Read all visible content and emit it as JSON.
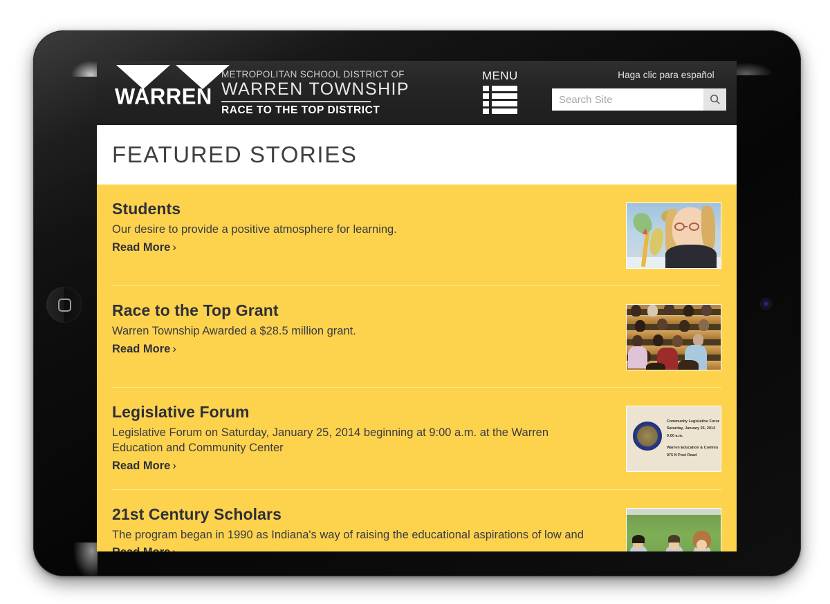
{
  "device": {
    "type": "tablet",
    "home_button": "home-button",
    "camera": "front-camera"
  },
  "header": {
    "logo_word": "WARREN",
    "line1": "METROPOLITAN SCHOOL DISTRICT OF",
    "line2": "WARREN TOWNSHIP",
    "line3": "RACE TO THE TOP DISTRICT",
    "menu_label": "MENU",
    "espanol_label": "Haga clic para español",
    "search_placeholder": "Search Site",
    "search_value": "",
    "bg_color": "#252525"
  },
  "page": {
    "title": "FEATURED STORIES",
    "accent_color": "#fdd34e",
    "title_color": "#3f3f3f"
  },
  "stories": [
    {
      "title": "Students",
      "desc": "Our desire to provide a positive atmosphere for learning.",
      "read_more": "Read More",
      "chevron": "›",
      "thumb_name": "thumbnail-student-with-map"
    },
    {
      "title": "Race to the Top Grant",
      "desc": "Warren Township Awarded a $28.5 million grant.",
      "read_more": "Read More",
      "chevron": "›",
      "thumb_name": "thumbnail-lecture-hall"
    },
    {
      "title": "Legislative Forum",
      "desc": "Legislative Forum on Saturday, January 25, 2014 beginning at 9:00 a.m. at the Warren Education and Community Center",
      "read_more": "Read More",
      "chevron": "›",
      "thumb_name": "thumbnail-legislative-forum-flyer",
      "flyer": {
        "line1": "Community Legislative Forum",
        "line2": "Saturday, January 25, 2014",
        "line3": "9:00 a.m.",
        "line4": "Warren Education & Commu",
        "line5": "975 N Post Road"
      }
    },
    {
      "title": "21st Century Scholars",
      "desc": "The program began in 1990 as Indiana's way of raising the educational aspirations of low and",
      "read_more": "Read More",
      "chevron": "›",
      "thumb_name": "thumbnail-students-on-grass"
    }
  ]
}
